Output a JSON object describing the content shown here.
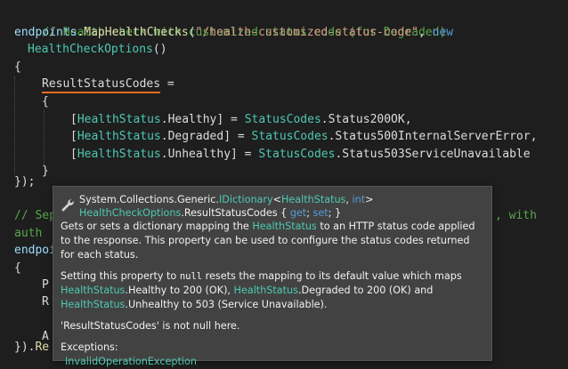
{
  "code": {
    "line1_comment": "// Health check with customized status code (for Degraded)",
    "line2": {
      "ident": "endpoints",
      "dot": ".",
      "method": "MapHealthChecks",
      "open": "(",
      "string": "\"/health-customized-status-code\"",
      "comma": ", ",
      "kw": "new"
    },
    "line3": {
      "type": "HealthCheckOptions",
      "parens": "()"
    },
    "line4": "{",
    "line5": {
      "prop": "ResultStatusCodes",
      "eq": " ="
    },
    "line6": "{",
    "map_rows": [
      {
        "open": "[",
        "type1": "HealthStatus",
        "member": ".Healthy",
        "close": "] = ",
        "type2": "StatusCodes",
        "value": ".Status200OK",
        "end": ","
      },
      {
        "open": "[",
        "type1": "HealthStatus",
        "member": ".Degraded",
        "close": "] = ",
        "type2": "StatusCodes",
        "value": ".Status500InternalServerError",
        "end": ","
      },
      {
        "open": "[",
        "type1": "HealthStatus",
        "member": ".Unhealthy",
        "close": "] = ",
        "type2": "StatusCodes",
        "value": ".Status503ServiceUnavailable",
        "end": ""
      }
    ],
    "line10": "}",
    "line11": "});",
    "line13_left": "// Sep",
    "line13_right": ", with",
    "line14": "auth",
    "line15": "endpoi",
    "line16": "{",
    "line17": "P",
    "line18": "R",
    "line20": "A",
    "line21_left": "}).",
    "line21_method": "Re"
  },
  "tooltip": {
    "sig_ns": "System.Collections.Generic.",
    "sig_iface": "IDictionary",
    "sig_lt": "<",
    "sig_type1": "HealthStatus",
    "sig_comma": ", ",
    "sig_kw": "int",
    "sig_gt": ">",
    "sig2_type": "HealthCheckOptions",
    "sig2_rest": ".ResultStatusCodes { ",
    "sig2_get": "get",
    "sig2_semi1": "; ",
    "sig2_set": "set",
    "sig2_end": "; }",
    "summary_a": "Gets or sets a dictionary mapping the ",
    "summary_type": "HealthStatus",
    "summary_b": " to an HTTP status code applied to the response. This property can be used to configure the status codes returned for each status.",
    "remarks_a": "Setting this property to ",
    "remarks_null": "null",
    "remarks_b": " resets the mapping to its default value which maps ",
    "r_t1": "HealthStatus",
    "r_m1": ".Healthy to 200 (OK), ",
    "r_t2": "HealthStatus",
    "r_m2": ".Degraded to 200 (OK) and ",
    "r_t3": "HealthStatus",
    "r_m3": ".Unhealthy to 503 (Service Unavailable).",
    "nullable": "'ResultStatusCodes' is not null here.",
    "exceptions_label": "Exceptions:",
    "exception_type": "InvalidOperationException"
  },
  "colors": {
    "background": "#1e1e1e",
    "comment": "#57a64a",
    "type": "#4ec9b0",
    "keyword": "#569cd6",
    "string": "#d69d85",
    "method": "#dcdcaa",
    "squiggle": "#f06a1e",
    "tooltip_bg": "#424242"
  },
  "icons": {
    "tooltip_icon": "wrench-icon"
  }
}
